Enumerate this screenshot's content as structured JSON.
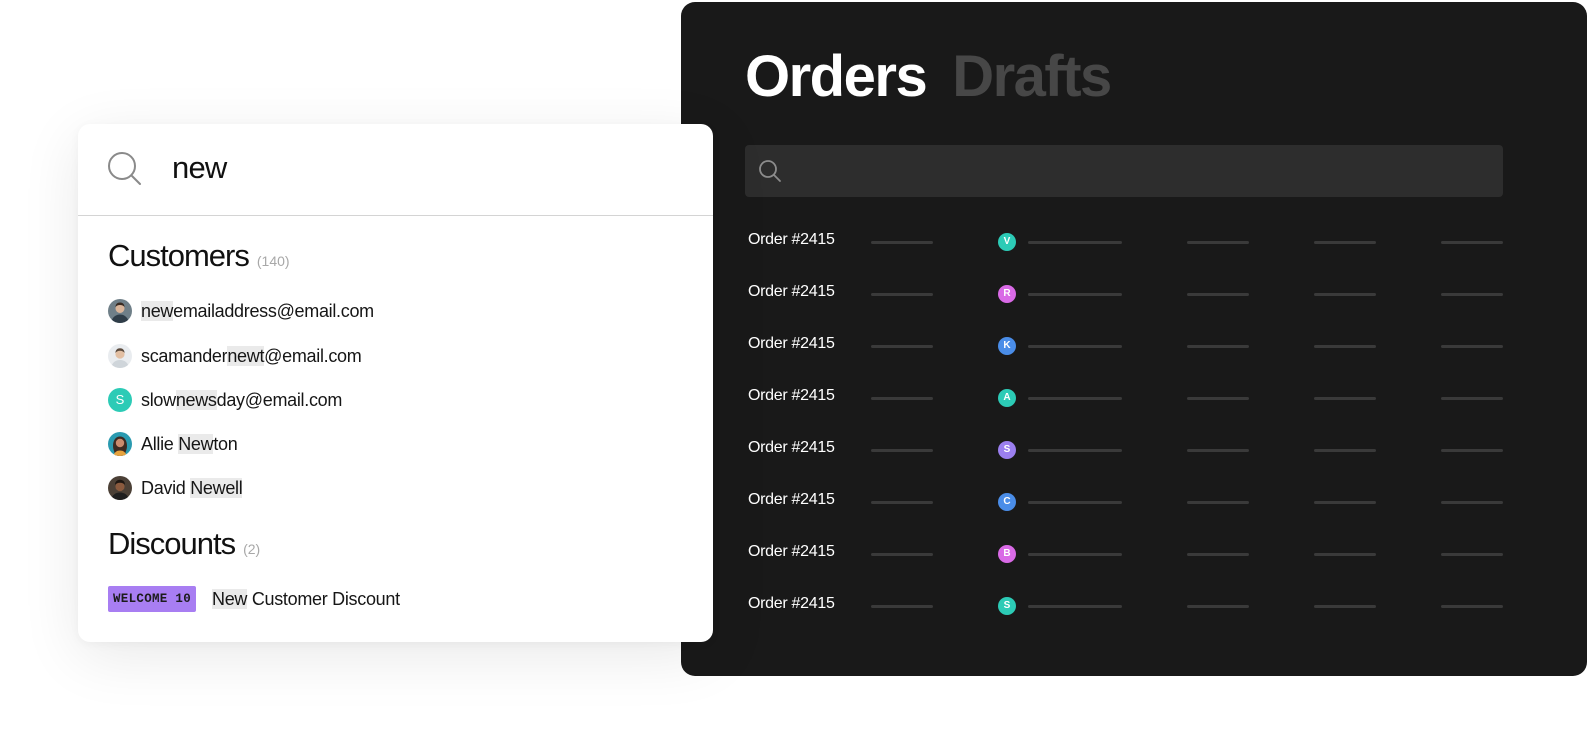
{
  "orders_panel": {
    "tabs": [
      {
        "label": "Orders",
        "active": true
      },
      {
        "label": "Drafts",
        "active": false
      }
    ],
    "search": {
      "icon": "search-icon"
    },
    "rows": [
      {
        "label": "Order #2415",
        "initial": "V",
        "color": "#2ccbb6"
      },
      {
        "label": "Order #2415",
        "initial": "R",
        "color": "#d96ae6"
      },
      {
        "label": "Order #2415",
        "initial": "K",
        "color": "#4a8de8"
      },
      {
        "label": "Order #2415",
        "initial": "A",
        "color": "#2ccbb6"
      },
      {
        "label": "Order #2415",
        "initial": "S",
        "color": "#9b7ff0"
      },
      {
        "label": "Order #2415",
        "initial": "C",
        "color": "#4a8de8"
      },
      {
        "label": "Order #2415",
        "initial": "B",
        "color": "#d96ae6"
      },
      {
        "label": "Order #2415",
        "initial": "S",
        "color": "#2ccbb6"
      }
    ]
  },
  "search_card": {
    "query": "new",
    "customers": {
      "title": "Customers",
      "count": "(140)",
      "items": [
        {
          "parts": [
            "",
            "new",
            "emailaddress@email.com"
          ],
          "avatar": "photo"
        },
        {
          "parts": [
            "scamander",
            "newt",
            "@email.com"
          ],
          "avatar": "photo"
        },
        {
          "parts": [
            "slow",
            "news",
            "day@email.com"
          ],
          "avatar": "initial",
          "initial": "S",
          "color": "#2ccbb6"
        },
        {
          "parts": [
            "Allie ",
            "New",
            "ton"
          ],
          "avatar": "photo"
        },
        {
          "parts": [
            "David ",
            "Newell",
            ""
          ],
          "avatar": "photo"
        }
      ]
    },
    "discounts": {
      "title": "Discounts",
      "count": "(2)",
      "items": [
        {
          "code": "WELCOME 10",
          "parts": [
            "",
            "New",
            " Customer Discount"
          ],
          "color": "#a87ef2"
        }
      ]
    }
  }
}
